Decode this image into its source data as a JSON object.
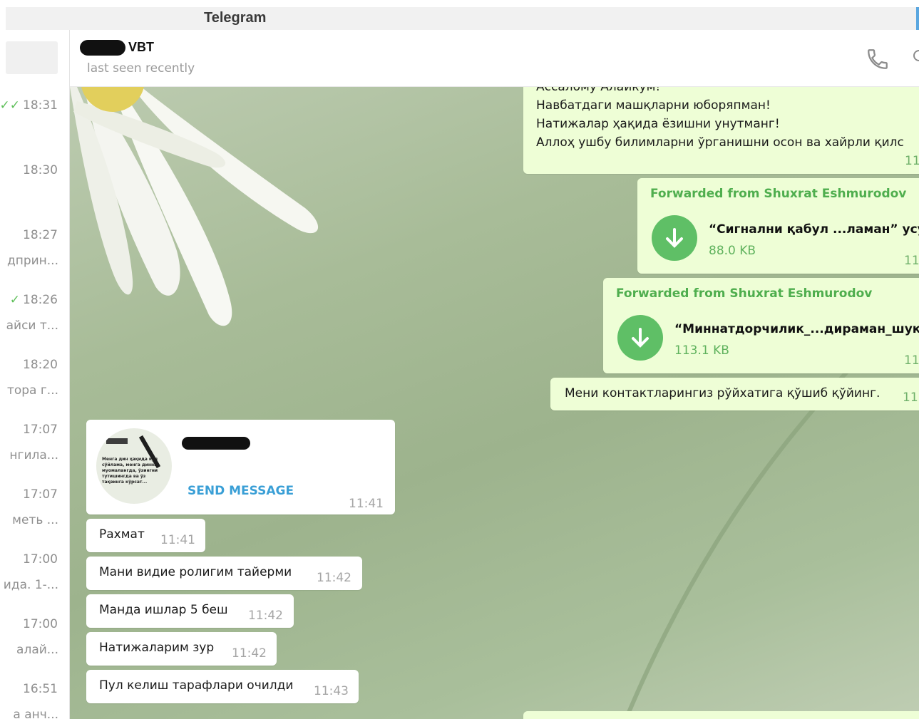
{
  "window": {
    "title": "Telegram"
  },
  "sidebar": {
    "rows": [
      {
        "time": "18:31",
        "check": "✓✓",
        "preview": ""
      },
      {
        "time": "18:30",
        "check": "",
        "preview": ""
      },
      {
        "time": "18:27",
        "check": "",
        "preview": "дприн..."
      },
      {
        "time": "18:26",
        "check": "✓",
        "preview": "айси т..."
      },
      {
        "time": "18:20",
        "check": "",
        "preview": "тора г..."
      },
      {
        "time": "17:07",
        "check": "",
        "preview": "нгила..."
      },
      {
        "time": "17:07",
        "check": "",
        "preview": "меть ..."
      },
      {
        "time": "17:00",
        "check": "",
        "preview": "ида. 1-..."
      },
      {
        "time": "17:00",
        "check": "",
        "preview": "алай..."
      },
      {
        "time": "16:51",
        "check": "",
        "preview": "а анч..."
      }
    ]
  },
  "header": {
    "name": "VBT",
    "status": "last seen recently"
  },
  "chat": {
    "outgoing_text": {
      "lines": [
        "Ассалому Алайкум!",
        "Навбатдаги машқларни юборяпман!",
        "Натижалар ҳақида ёзишни унутманг!",
        "Аллоҳ ушбу билимларни ўрганишни осон ва хайрли қилс"
      ],
      "time": "11"
    },
    "file1": {
      "forwarded": "Forwarded from Shuxrat Eshmurodov",
      "name": "“Сигнални қабул ...ламан” усул",
      "size": "88.0 KB",
      "time": "11"
    },
    "file2": {
      "forwarded": "Forwarded from Shuxrat Eshmurodov",
      "name": "“Миннатдорчилик_...дираман_шукр",
      "size": "113.1 KB",
      "time": "11"
    },
    "contact_msg": {
      "text": "Мени контактларингиз рўйхатига қўшиб қўйинг.",
      "time": "11"
    },
    "contact_card": {
      "avatar_text": "Менга дин ҳақида кўп сўйлама, менга динни муомалангда, ўзингни тутишингда ва ўз тақвинга кўрсат...",
      "action": "SEND MESSAGE",
      "time": "11:41"
    },
    "incoming": [
      {
        "text": "Рахмат",
        "time": "11:41"
      },
      {
        "text": "Мани видие ролигим тайерми",
        "time": "11:42"
      },
      {
        "text": "Манда ишлар 5 беш",
        "time": "11:42"
      },
      {
        "text": "Натижаларим зур",
        "time": "11:42"
      },
      {
        "text": "Пул келиш тарафлари очилди",
        "time": "11:43"
      }
    ]
  }
}
